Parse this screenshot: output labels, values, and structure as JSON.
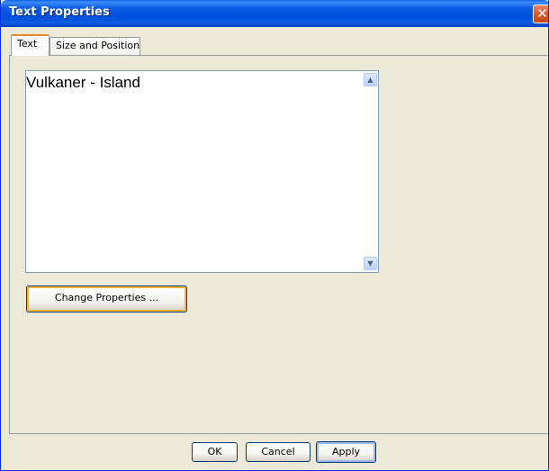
{
  "window": {
    "title": "Text Properties",
    "close_glyph": "✕",
    "close_icon": "close-icon"
  },
  "tabs": [
    {
      "label": "Text",
      "active": true
    },
    {
      "label": "Size and Position",
      "active": false
    }
  ],
  "text_area": {
    "value": "Vulkaner - Island",
    "scroll_up_glyph": "▲",
    "scroll_down_glyph": "▼"
  },
  "buttons": {
    "change_properties": "Change Properties ...",
    "ok": "OK",
    "cancel": "Cancel",
    "apply": "Apply"
  },
  "colors": {
    "titlebar": "#0054e3",
    "dialog_bg": "#ece9d8",
    "close": "#d9502b",
    "focus_accent": "#f8b33b"
  }
}
